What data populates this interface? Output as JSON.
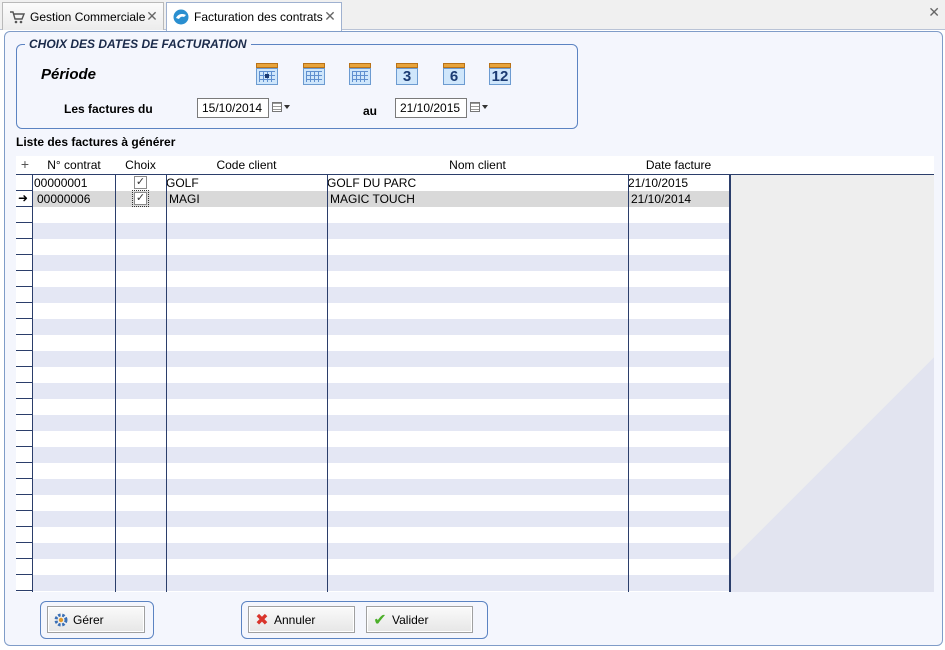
{
  "tabs": [
    {
      "label": "Gestion Commerciale",
      "icon": "shopping-cart-icon",
      "close": "✕"
    },
    {
      "label": "Facturation des contrats",
      "icon": "contract-billing-icon",
      "close": "✕"
    }
  ],
  "window_close": "✕",
  "period_group": {
    "legend": "CHOIX DES DATES DE FACTURATION",
    "periode_label": "Période",
    "period_buttons": [
      {
        "name": "period-day-button",
        "icon": "calendar-day-icon",
        "text": ""
      },
      {
        "name": "period-week-button",
        "icon": "calendar-week-icon",
        "text": ""
      },
      {
        "name": "period-month-button",
        "icon": "calendar-month-icon",
        "text": ""
      },
      {
        "name": "period-3-months-button",
        "icon": "calendar-3-icon",
        "text": "3"
      },
      {
        "name": "period-6-months-button",
        "icon": "calendar-6-icon",
        "text": "6"
      },
      {
        "name": "period-12-months-button",
        "icon": "calendar-12-icon",
        "text": "12"
      }
    ],
    "from_label": "Les factures du",
    "from_value": "15/10/2014",
    "to_label": "au",
    "to_value": "21/10/2015"
  },
  "list_title": "Liste des factures à générer",
  "grid": {
    "add_icon": "+",
    "columns": [
      "N° contrat",
      "Choix",
      "Code client",
      "Nom client",
      "Date facture"
    ],
    "rows": [
      {
        "contrat": "00000001",
        "choix": true,
        "code": "GOLF",
        "nom": "GOLF DU PARC",
        "date": "21/10/2015",
        "selected": false
      },
      {
        "contrat": "00000006",
        "choix": true,
        "code": "MAGI",
        "nom": "MAGIC TOUCH",
        "date": "21/10/2014",
        "selected": true
      }
    ],
    "current_row_marker": "➜"
  },
  "buttons": {
    "gerer": "Gérer",
    "annuler": "Annuler",
    "valider": "Valider"
  },
  "colors": {
    "accent_border": "#5b83c2",
    "panel_bg": "#f4f6fd",
    "alt_row": "#e4e7f4"
  }
}
